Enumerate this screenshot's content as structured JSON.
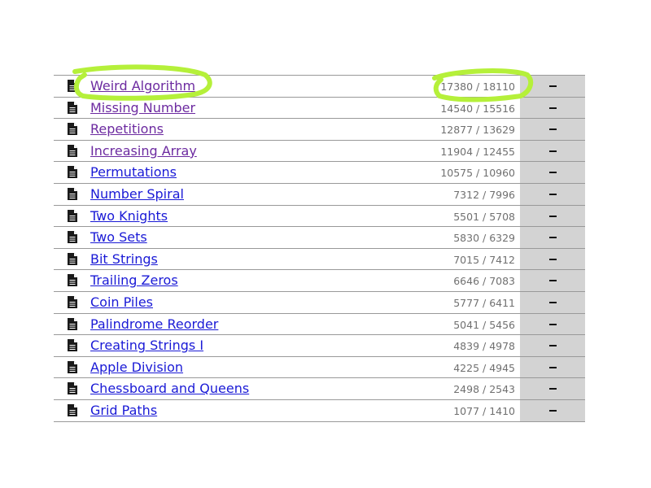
{
  "tasks": [
    {
      "name": "Weird Algorithm",
      "stats": "17380 / 18110",
      "status": "−",
      "visited": true
    },
    {
      "name": "Missing Number",
      "stats": "14540 / 15516",
      "status": "−",
      "visited": true
    },
    {
      "name": "Repetitions",
      "stats": "12877 / 13629",
      "status": "−",
      "visited": true
    },
    {
      "name": "Increasing Array",
      "stats": "11904 / 12455",
      "status": "−",
      "visited": true
    },
    {
      "name": "Permutations",
      "stats": "10575 / 10960",
      "status": "−",
      "visited": false
    },
    {
      "name": "Number Spiral",
      "stats": "7312 / 7996",
      "status": "−",
      "visited": false
    },
    {
      "name": "Two Knights",
      "stats": "5501 / 5708",
      "status": "−",
      "visited": false
    },
    {
      "name": "Two Sets",
      "stats": "5830 / 6329",
      "status": "−",
      "visited": false
    },
    {
      "name": "Bit Strings",
      "stats": "7015 / 7412",
      "status": "−",
      "visited": false
    },
    {
      "name": "Trailing Zeros",
      "stats": "6646 / 7083",
      "status": "−",
      "visited": false
    },
    {
      "name": "Coin Piles",
      "stats": "5777 / 6411",
      "status": "−",
      "visited": false
    },
    {
      "name": "Palindrome Reorder",
      "stats": "5041 / 5456",
      "status": "−",
      "visited": false
    },
    {
      "name": "Creating Strings I",
      "stats": "4839 / 4978",
      "status": "−",
      "visited": false
    },
    {
      "name": "Apple Division",
      "stats": "4225 / 4945",
      "status": "−",
      "visited": false
    },
    {
      "name": "Chessboard and Queens",
      "stats": "2498 / 2543",
      "status": "−",
      "visited": false
    },
    {
      "name": "Grid Paths",
      "stats": "1077 / 1410",
      "status": "−",
      "visited": false
    }
  ],
  "icons": {
    "task": "document-icon"
  },
  "colors": {
    "visited_link": "#6c2aa0",
    "unvisited_link": "#1a1ad6",
    "stats_text": "#707070",
    "status_cell": "#d3d3d3",
    "highlight": "#b5f03a"
  },
  "annotations": [
    "circle around Weird Algorithm",
    "circle around 17380 / 18110"
  ]
}
